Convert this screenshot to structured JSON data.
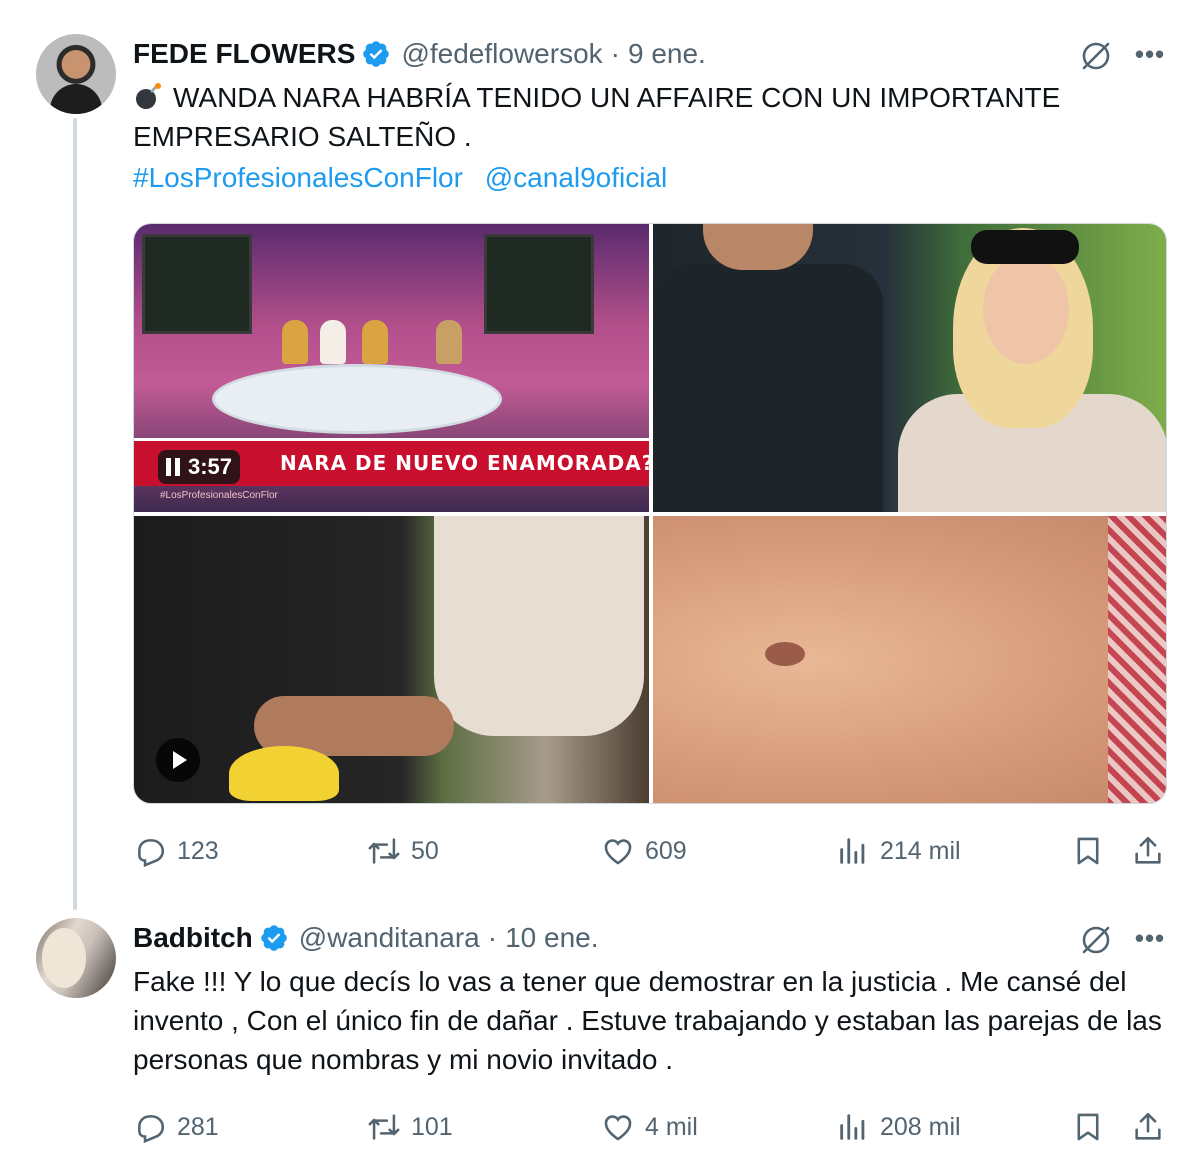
{
  "tweets": [
    {
      "author": {
        "name": "FEDE FLOWERS",
        "handle": "@fedeflowersok",
        "verified": true
      },
      "separator": "·",
      "date": "9 ene.",
      "emoji": "bomb-icon",
      "text": "WANDA NARA HABRÍA TENIDO UN AFFAIRE CON UN IMPORTANTE EMPRESARIO SALTEÑO .",
      "hashtags": [
        "#LosProfesionalesConFlor",
        "@canal9oficial"
      ],
      "media": {
        "video_timer": "3:57",
        "banner_text": "NARA DE NUEVO ENAMORADA?",
        "banner_sub": "#LosProfesionalesConFlor"
      },
      "stats": {
        "replies": "123",
        "retweets": "50",
        "likes": "609",
        "views": "214 mil"
      }
    },
    {
      "author": {
        "name": "Badbitch",
        "handle": "@wanditanara",
        "verified": true
      },
      "separator": "·",
      "date": "10 ene.",
      "text": "Fake !!! Y lo que decís lo vas a tener que demostrar en la justicia . Me cansé del invento , Con el único fin de dañar . Estuve trabajando y estaban las parejas de las personas que nombras  y mi novio invitado .",
      "stats": {
        "replies": "281",
        "retweets": "101",
        "likes": "4 mil",
        "views": "208 mil"
      }
    }
  ],
  "colors": {
    "accent": "#1d9bf0",
    "muted": "#536471",
    "text": "#0f1419",
    "verified": "#1d9bf0"
  }
}
